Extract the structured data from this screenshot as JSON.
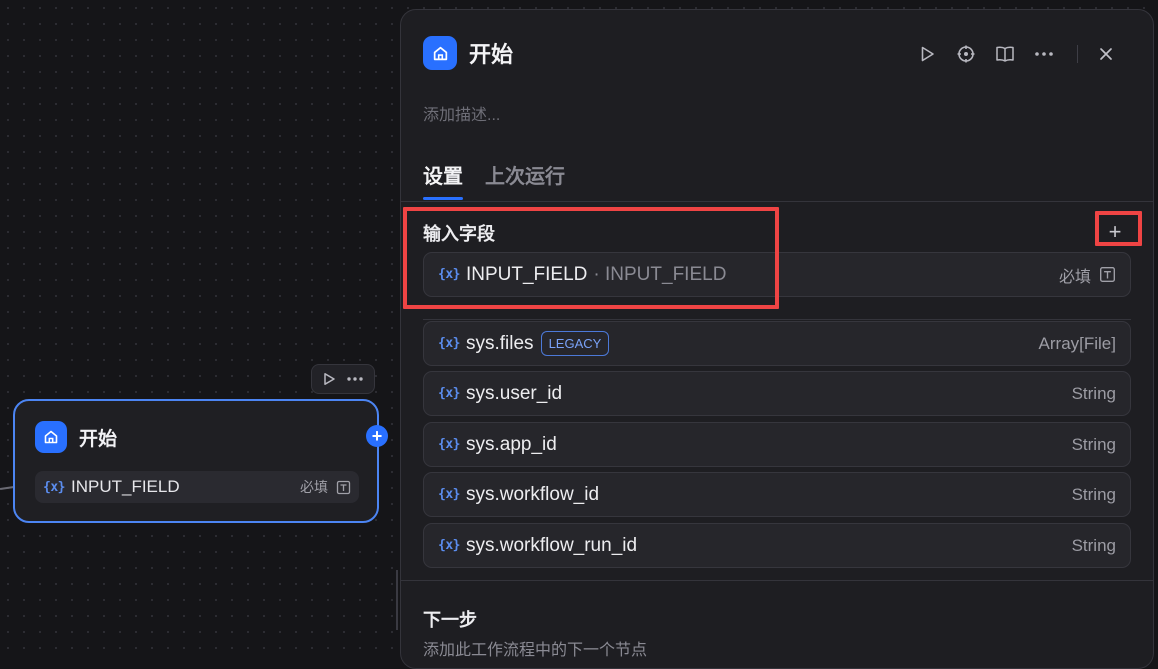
{
  "node": {
    "title": "开始",
    "field_name": "INPUT_FIELD",
    "var_icon": "{x}",
    "required_label": "必填",
    "plus_symbol": "+"
  },
  "panel": {
    "title": "开始",
    "description_placeholder": "添加描述...",
    "tabs": [
      {
        "label": "设置",
        "active": true
      },
      {
        "label": "上次运行",
        "active": false
      }
    ],
    "input_section": {
      "title": "输入字段",
      "add_symbol": "+",
      "field": {
        "name": "INPUT_FIELD",
        "alias": "· INPUT_FIELD",
        "required_label": "必填"
      }
    },
    "system_vars": [
      {
        "name": "sys.files",
        "badge": "LEGACY",
        "type": "Array[File]"
      },
      {
        "name": "sys.user_id",
        "type": "String"
      },
      {
        "name": "sys.app_id",
        "type": "String"
      },
      {
        "name": "sys.workflow_id",
        "type": "String"
      },
      {
        "name": "sys.workflow_run_id",
        "type": "String"
      }
    ],
    "next_step": {
      "title": "下一步",
      "description": "添加此工作流程中的下一个节点"
    }
  },
  "icons": {
    "home": "home-icon",
    "play": "play-icon",
    "crosshair": "crosshair-icon",
    "book": "book-icon",
    "more": "more-icon",
    "close": "close-icon",
    "text_type": "text-type-icon",
    "variable": "variable-icon"
  },
  "colors": {
    "accent": "#2970ff",
    "highlight": "#ef4444",
    "background": "#151518",
    "panel": "#1e1e22"
  }
}
